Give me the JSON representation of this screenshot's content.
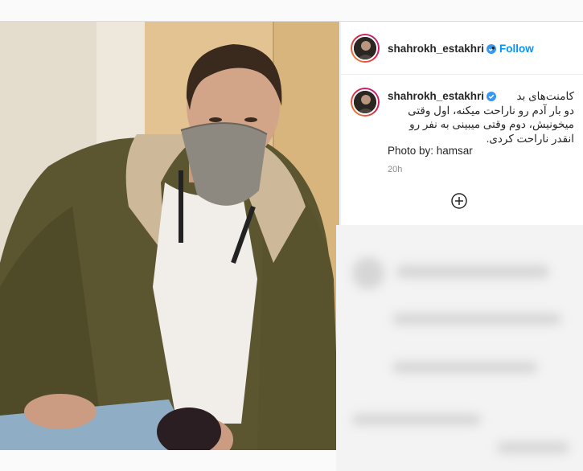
{
  "post": {
    "author": {
      "username": "shahrokh_estakhri",
      "verified": true
    },
    "header": {
      "separator": "•",
      "follow_label": "Follow"
    },
    "caption": {
      "lines": [
        "کامنت‌های بد",
        "دو بار آدم رو ناراحت میکنه، اول وقتی",
        "میخونیش، دوم وقتی میبینی به نفر رو",
        "انقدر ناراحت کردی."
      ],
      "photo_credit": "Photo by: hamsar"
    },
    "timestamp": "20h"
  },
  "colors": {
    "accent": "#0095f6",
    "verified_badge": "#3897f0",
    "text": "#262626",
    "muted": "#8e8e8e"
  },
  "icons": {
    "verified": "verified-badge-icon",
    "load_more": "plus-circle-icon"
  }
}
